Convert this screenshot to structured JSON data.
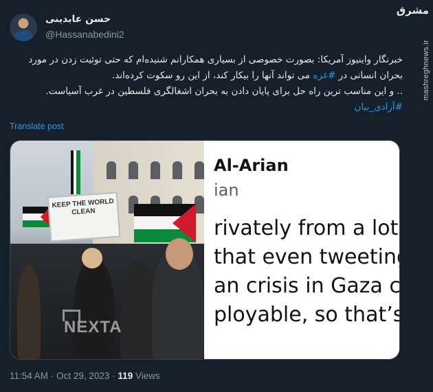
{
  "author": {
    "display_name": "حسن عابدینی",
    "handle": "@Hassanabedini2"
  },
  "watermark": {
    "logo": "مشرق",
    "site": "mashreghnews.ir"
  },
  "tweet": {
    "lines": [
      "خبرنگار واینیوز آمریکا: بصورت خصوصی از بسیاری همکارانم شنیده‌ام که حتی توئیت زدن در مورد",
      "از این رو سکوت کرده‌اند.",
      ".. و این مناسب ترین راه حل برای پایان دادن به بحران اشغالگری فلسطین در غرب آسیاست."
    ],
    "line2_prefix": "بحران انسانی در",
    "line2_hashtag": "#غزه",
    "line2_suffix": "می تواند آنها را بیکار کند،",
    "hashtag_last": "#آزادی_بیان",
    "translate_label": "Translate post"
  },
  "media": {
    "sign_text": "KEEP THE WORLD CLEAN",
    "photo_watermark": "NEXTA",
    "quote_name": "Al-Arian",
    "quote_handle": "ian",
    "quote_lines": [
      "rivately from a lot o",
      "that even tweeting a",
      "an crisis in Gaza cou",
      "ployable, so that’s w"
    ]
  },
  "meta": {
    "time": "11:54 AM",
    "separator": "·",
    "date": "Oct 29, 2023",
    "views_count": "119",
    "views_label": "Views"
  },
  "colors": {
    "background": "#15202b",
    "link": "#1d9bf0",
    "muted": "#8b98a5"
  }
}
